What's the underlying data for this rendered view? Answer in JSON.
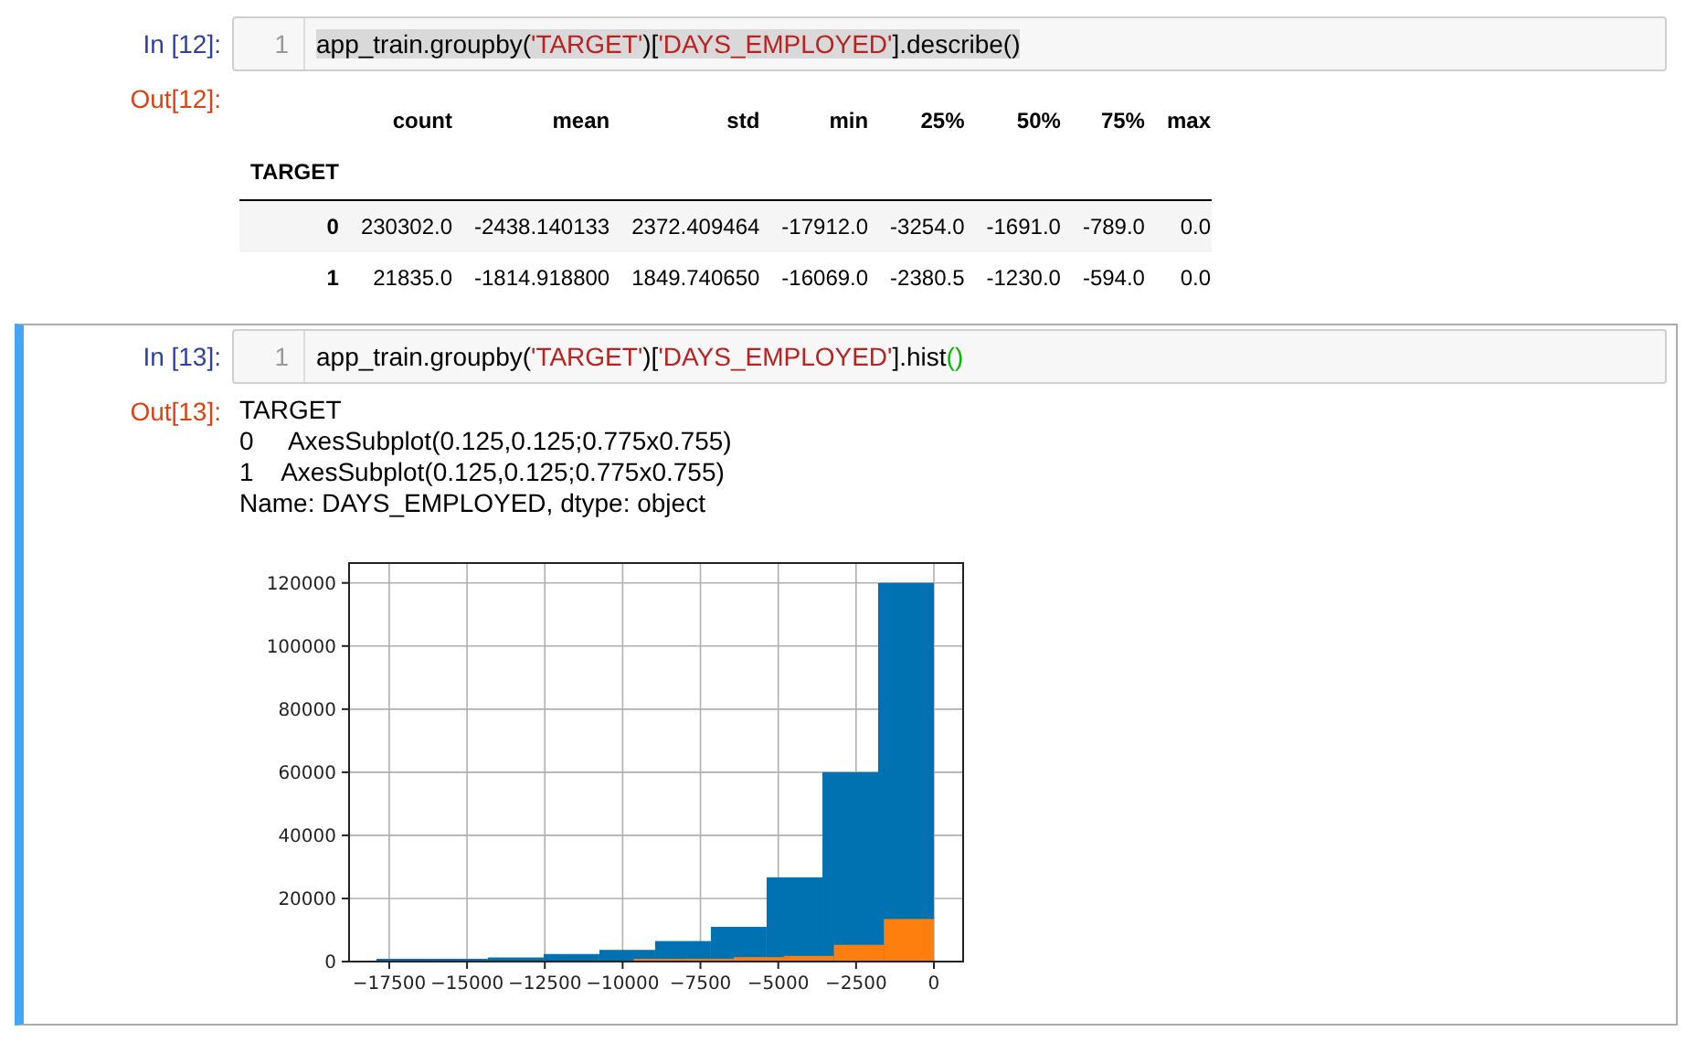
{
  "cells": [
    {
      "selected": false,
      "in_prompt": "In [12]:",
      "line_number": "1",
      "code_highlighted": true,
      "code": [
        {
          "text": "app_train.groupby(",
          "kind": "plain"
        },
        {
          "text": "'TARGET'",
          "kind": "string"
        },
        {
          "text": ")[",
          "kind": "plain"
        },
        {
          "text": "'DAYS_EMPLOYED'",
          "kind": "string"
        },
        {
          "text": "].describe()",
          "kind": "plain"
        }
      ],
      "out_prompt": "Out[12]:",
      "output": {
        "kind": "table",
        "columns": [
          "count",
          "mean",
          "std",
          "min",
          "25%",
          "50%",
          "75%",
          "max"
        ],
        "index_name": "TARGET",
        "rows": [
          {
            "index": "0",
            "cells": [
              "230302.0",
              "-2438.140133",
              "2372.409464",
              "-17912.0",
              "-3254.0",
              "-1691.0",
              "-789.0",
              "0.0"
            ]
          },
          {
            "index": "1",
            "cells": [
              "21835.0",
              "-1814.918800",
              "1849.740650",
              "-16069.0",
              "-2380.5",
              "-1230.0",
              "-594.0",
              "0.0"
            ]
          }
        ]
      }
    },
    {
      "selected": true,
      "in_prompt": "In [13]:",
      "line_number": "1",
      "code_highlighted": false,
      "code": [
        {
          "text": "app_train.groupby(",
          "kind": "plain"
        },
        {
          "text": "'TARGET'",
          "kind": "string"
        },
        {
          "text": ")[",
          "kind": "plain"
        },
        {
          "text": "'DAYS_EMPLOYED'",
          "kind": "string"
        },
        {
          "text": "].hist",
          "kind": "plain"
        },
        {
          "text": "()",
          "kind": "bracket"
        }
      ],
      "out_prompt": "Out[13]:",
      "output": {
        "kind": "text_and_chart",
        "lines": [
          "TARGET",
          "0     AxesSubplot(0.125,0.125;0.775x0.755)",
          "1    AxesSubplot(0.125,0.125;0.775x0.755)",
          "Name: DAYS_EMPLOYED, dtype: object"
        ],
        "chart_data": {
          "type": "bar",
          "grid": true,
          "xlim": [
            -18790,
            940
          ],
          "ylim": [
            0,
            126300
          ],
          "xticks": [
            {
              "value": -17500,
              "label": "−17500"
            },
            {
              "value": -15000,
              "label": "−15000"
            },
            {
              "value": -12500,
              "label": "−12500"
            },
            {
              "value": -10000,
              "label": "−10000"
            },
            {
              "value": -7500,
              "label": "−7500"
            },
            {
              "value": -5000,
              "label": "−5000"
            },
            {
              "value": -2500,
              "label": "−2500"
            },
            {
              "value": 0,
              "label": "0"
            }
          ],
          "yticks": [
            0,
            20000,
            40000,
            60000,
            80000,
            100000,
            120000
          ],
          "series": [
            {
              "color": "#0072b2",
              "x": [
                -17912,
                -16121,
                -14330,
                -12538,
                -10747,
                -8956,
                -7165,
                -5374,
                -3582,
                -1791
              ],
              "values": [
                300,
                800,
                1300,
                2400,
                3700,
                6500,
                11000,
                26700,
                60000,
                120000
              ]
            },
            {
              "color": "#ff7f0e",
              "x": [
                -9641,
                -8034,
                -6428,
                -4821,
                -3214,
                -1607
              ],
              "values": [
                700,
                900,
                1400,
                1800,
                5300,
                13500
              ]
            }
          ]
        }
      }
    }
  ]
}
